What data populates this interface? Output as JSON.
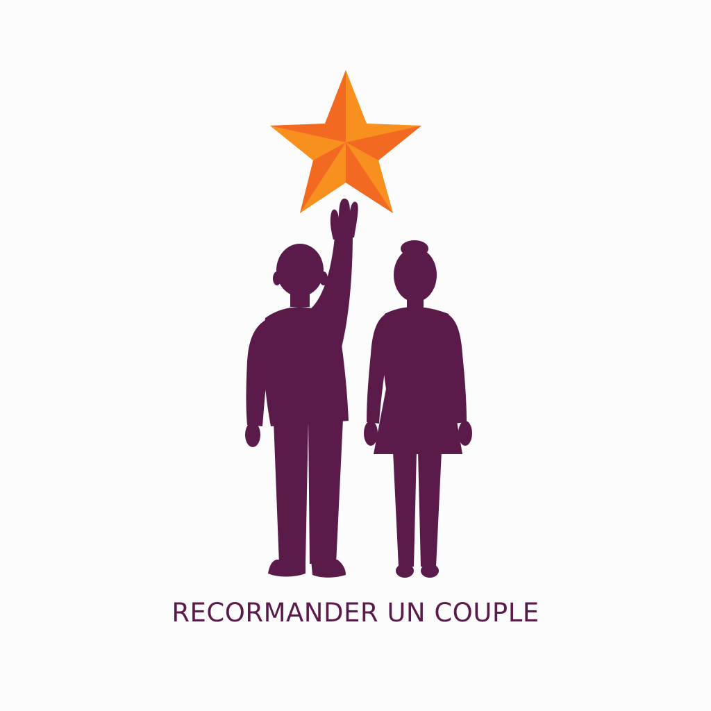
{
  "caption": {
    "text": "RECORMANDER UN COUPLE"
  },
  "colors": {
    "background": "#fdfcfd",
    "silhouette": "#5a1b4a",
    "star_light": "#f7901e",
    "star_dark": "#f26a21",
    "caption": "#5a1b4a"
  },
  "icons": {
    "star": "star-icon",
    "man": "man-silhouette-icon",
    "woman": "woman-silhouette-icon"
  }
}
